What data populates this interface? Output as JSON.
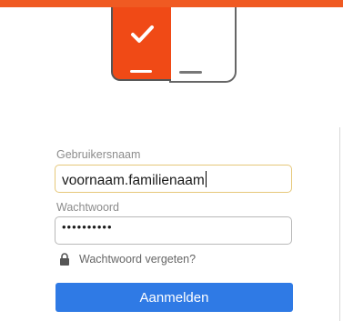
{
  "brand": {
    "accent_color": "#f05a22",
    "logo_icon": "check-icon"
  },
  "form": {
    "username_label": "Gebruikersnaam",
    "username_value": "voornaam.familienaam",
    "password_label": "Wachtwoord",
    "password_value": "••••••••••",
    "forgot_icon": "lock-icon",
    "forgot_link": "Wachtwoord vergeten?",
    "submit_label": "Aanmelden",
    "submit_color": "#2f7ae5"
  }
}
